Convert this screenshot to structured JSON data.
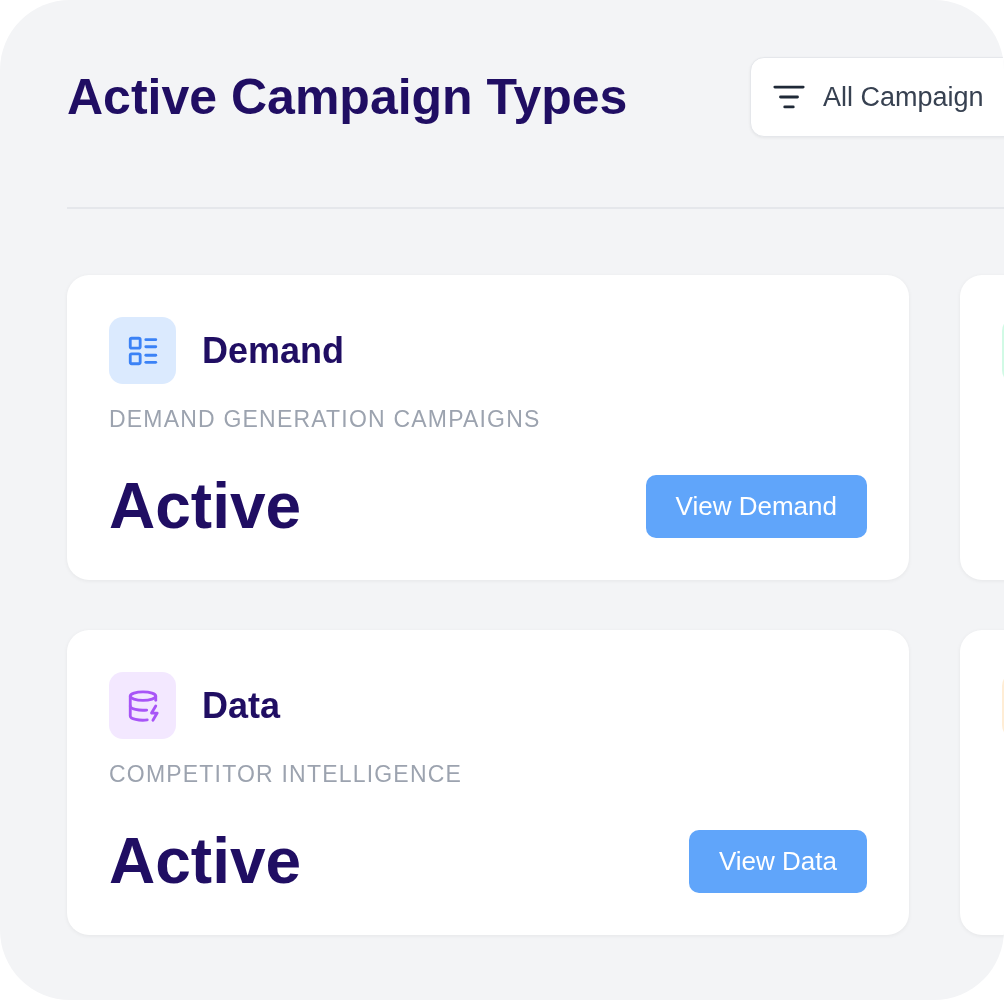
{
  "header": {
    "title": "Active Campaign Types",
    "filter": {
      "label": "All Campaign"
    }
  },
  "cards": [
    {
      "kind": "list",
      "color": "#dbeafe",
      "title": "Demand",
      "subtitle": "DEMAND GENERATION CAMPAIGNS",
      "status": "Active",
      "button": "View Demand"
    },
    {
      "kind": "partial",
      "color": "#d1fae5"
    },
    {
      "kind": "database",
      "color": "#f3e8ff",
      "title": "Data",
      "subtitle": "COMPETITOR INTELLIGENCE",
      "status": "Active",
      "button": "View Data"
    },
    {
      "kind": "partial",
      "color": "#ffedd5"
    }
  ]
}
